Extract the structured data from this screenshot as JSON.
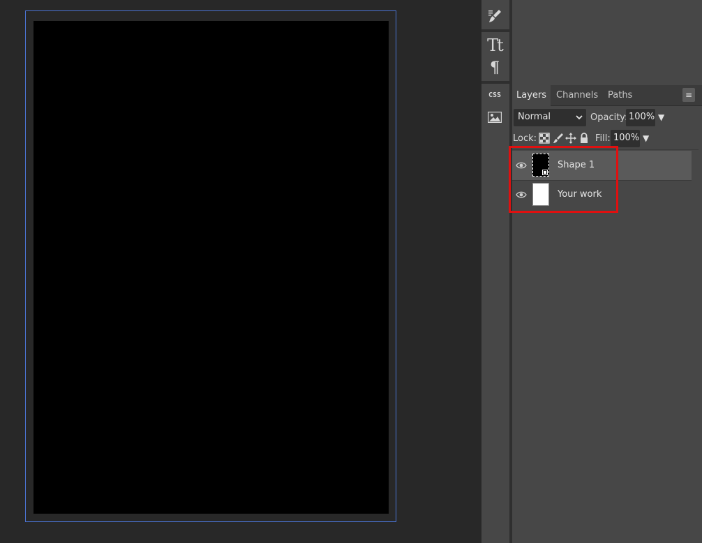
{
  "tools": {
    "brush_icon": "brush-settings-icon",
    "type_icon": "type-icon",
    "paragraph_icon": "paragraph-icon",
    "css_label": "CSS",
    "image_icon": "image-icon"
  },
  "layers_panel": {
    "tabs": [
      {
        "label": "Layers",
        "active": true
      },
      {
        "label": "Channels",
        "active": false
      },
      {
        "label": "Paths",
        "active": false
      }
    ],
    "menu_icon": "hamburger-icon",
    "blend_mode": "Normal",
    "opacity_label": "Opacity:",
    "opacity_value": "100%",
    "lock_label": "Lock:",
    "fill_label": "Fill:",
    "fill_value": "100%",
    "layers": [
      {
        "name": "Shape 1",
        "selected": true,
        "thumb": "black"
      },
      {
        "name": "Your work",
        "selected": false,
        "thumb": "white"
      }
    ]
  },
  "colors": {
    "canvas_border": "#4b74d4",
    "highlight": "#e01010",
    "selected_row": "#5a5a5a"
  }
}
